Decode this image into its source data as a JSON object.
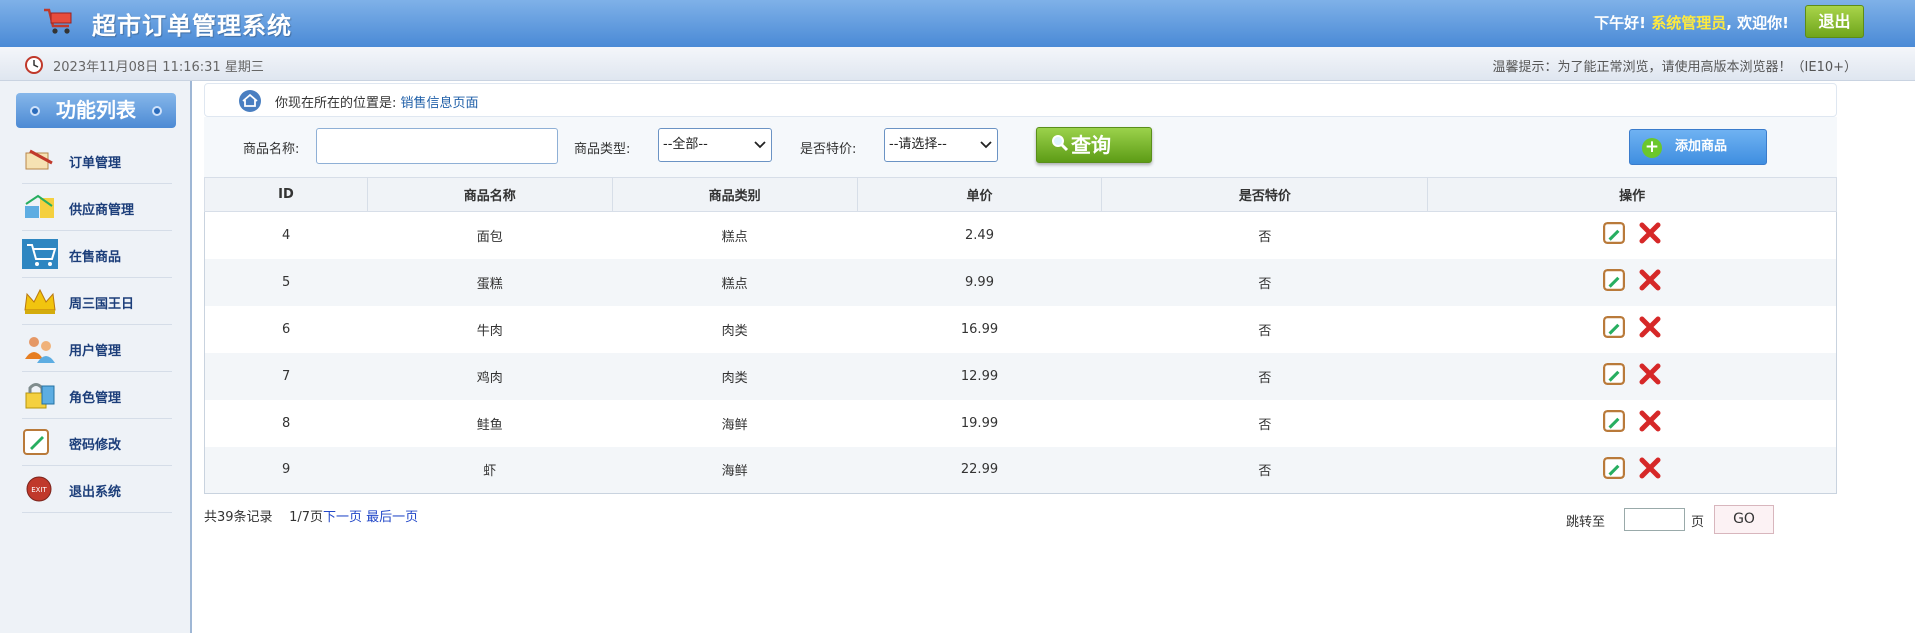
{
  "header": {
    "title": "超市订单管理系统",
    "greeting": "下午好!",
    "user_role": "系统管理员",
    "welcome": ", 欢迎你!",
    "logout_label": "退出"
  },
  "subbar": {
    "datetime": "2023年11月08日 11:16:31 星期三",
    "tip": "温馨提示：为了能正常浏览，请使用高版本浏览器！（IE10+）"
  },
  "sidebar": {
    "title": "功能列表",
    "items": [
      {
        "label": "订单管理",
        "icon": "order-icon"
      },
      {
        "label": "供应商管理",
        "icon": "supplier-icon"
      },
      {
        "label": "在售商品",
        "icon": "cart-icon"
      },
      {
        "label": "周三国王日",
        "icon": "crown-icon"
      },
      {
        "label": "用户管理",
        "icon": "users-icon"
      },
      {
        "label": "角色管理",
        "icon": "lock-icon"
      },
      {
        "label": "密码修改",
        "icon": "pencil-icon"
      },
      {
        "label": "退出系统",
        "icon": "exit-icon"
      }
    ]
  },
  "breadcrumb": {
    "prefix": "你现在所在的位置是:",
    "page": "销售信息页面"
  },
  "filter": {
    "name_label": "商品名称:",
    "name_value": "",
    "type_label": "商品类型:",
    "type_selected": "--全部--",
    "special_label": "是否特价:",
    "special_selected": "--请选择--",
    "query_label": "查询",
    "add_label": "添加商品"
  },
  "table": {
    "headers": [
      "ID",
      "商品名称",
      "商品类别",
      "单价",
      "是否特价",
      "操作"
    ],
    "rows": [
      {
        "id": "4",
        "name": "面包",
        "category": "糕点",
        "price": "2.49",
        "special": "否"
      },
      {
        "id": "5",
        "name": "蛋糕",
        "category": "糕点",
        "price": "9.99",
        "special": "否"
      },
      {
        "id": "6",
        "name": "牛肉",
        "category": "肉类",
        "price": "16.99",
        "special": "否"
      },
      {
        "id": "7",
        "name": "鸡肉",
        "category": "肉类",
        "price": "12.99",
        "special": "否"
      },
      {
        "id": "8",
        "name": "鲑鱼",
        "category": "海鲜",
        "price": "19.99",
        "special": "否"
      },
      {
        "id": "9",
        "name": "虾",
        "category": "海鲜",
        "price": "22.99",
        "special": "否"
      }
    ]
  },
  "pager": {
    "total": "共39条记录",
    "page_info": "1/7页",
    "next": "下一页",
    "last": "最后一页",
    "jump_label": "跳转至",
    "jump_value": "",
    "page_unit": "页",
    "go_label": "GO"
  },
  "colors": {
    "header_top": "#7fb1e8",
    "header_bottom": "#4a8ad6",
    "role_color": "#ffea3d",
    "link_color": "#2348c8"
  }
}
